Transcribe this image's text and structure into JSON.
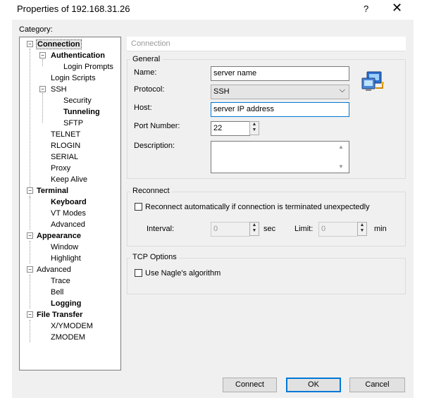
{
  "window": {
    "title": "Properties of 192.168.31.26",
    "help_label": "?",
    "close_label": "✕"
  },
  "category_label": "Category:",
  "tree": [
    {
      "label": "Connection",
      "bold": true,
      "selected": true,
      "toggle": "−"
    },
    {
      "label": "Authentication",
      "bold": true,
      "toggle": "−"
    },
    {
      "label": "Login Prompts"
    },
    {
      "label": "Login Scripts"
    },
    {
      "label": "SSH",
      "toggle": "−"
    },
    {
      "label": "Security"
    },
    {
      "label": "Tunneling",
      "bold": true
    },
    {
      "label": "SFTP"
    },
    {
      "label": "TELNET"
    },
    {
      "label": "RLOGIN"
    },
    {
      "label": "SERIAL"
    },
    {
      "label": "Proxy"
    },
    {
      "label": "Keep Alive"
    },
    {
      "label": "Terminal",
      "bold": true,
      "toggle": "−"
    },
    {
      "label": "Keyboard",
      "bold": true
    },
    {
      "label": "VT Modes"
    },
    {
      "label": "Advanced"
    },
    {
      "label": "Appearance",
      "bold": true,
      "toggle": "−"
    },
    {
      "label": "Window"
    },
    {
      "label": "Highlight"
    },
    {
      "label": "Advanced",
      "toggle": "−"
    },
    {
      "label": "Trace"
    },
    {
      "label": "Bell"
    },
    {
      "label": "Logging",
      "bold": true
    },
    {
      "label": "File Transfer",
      "bold": true,
      "toggle": "−"
    },
    {
      "label": "X/YMODEM"
    },
    {
      "label": "ZMODEM"
    }
  ],
  "section_title": "Connection",
  "general": {
    "legend": "General",
    "name_label": "Name:",
    "name_value": "server name",
    "protocol_label": "Protocol:",
    "protocol_value": "SSH",
    "host_label": "Host:",
    "host_value": "server IP address",
    "port_label": "Port Number:",
    "port_value": "22",
    "description_label": "Description:",
    "description_value": ""
  },
  "reconnect": {
    "legend": "Reconnect",
    "checkbox_label": "Reconnect automatically if connection is terminated unexpectedly",
    "interval_label": "Interval:",
    "interval_value": "0",
    "interval_unit": "sec",
    "limit_label": "Limit:",
    "limit_value": "0",
    "limit_unit": "min"
  },
  "tcp": {
    "legend": "TCP Options",
    "nagle_label": "Use Nagle's algorithm"
  },
  "buttons": {
    "connect": "Connect",
    "ok": "OK",
    "cancel": "Cancel"
  },
  "icons": {
    "network": "network-computers-icon"
  }
}
